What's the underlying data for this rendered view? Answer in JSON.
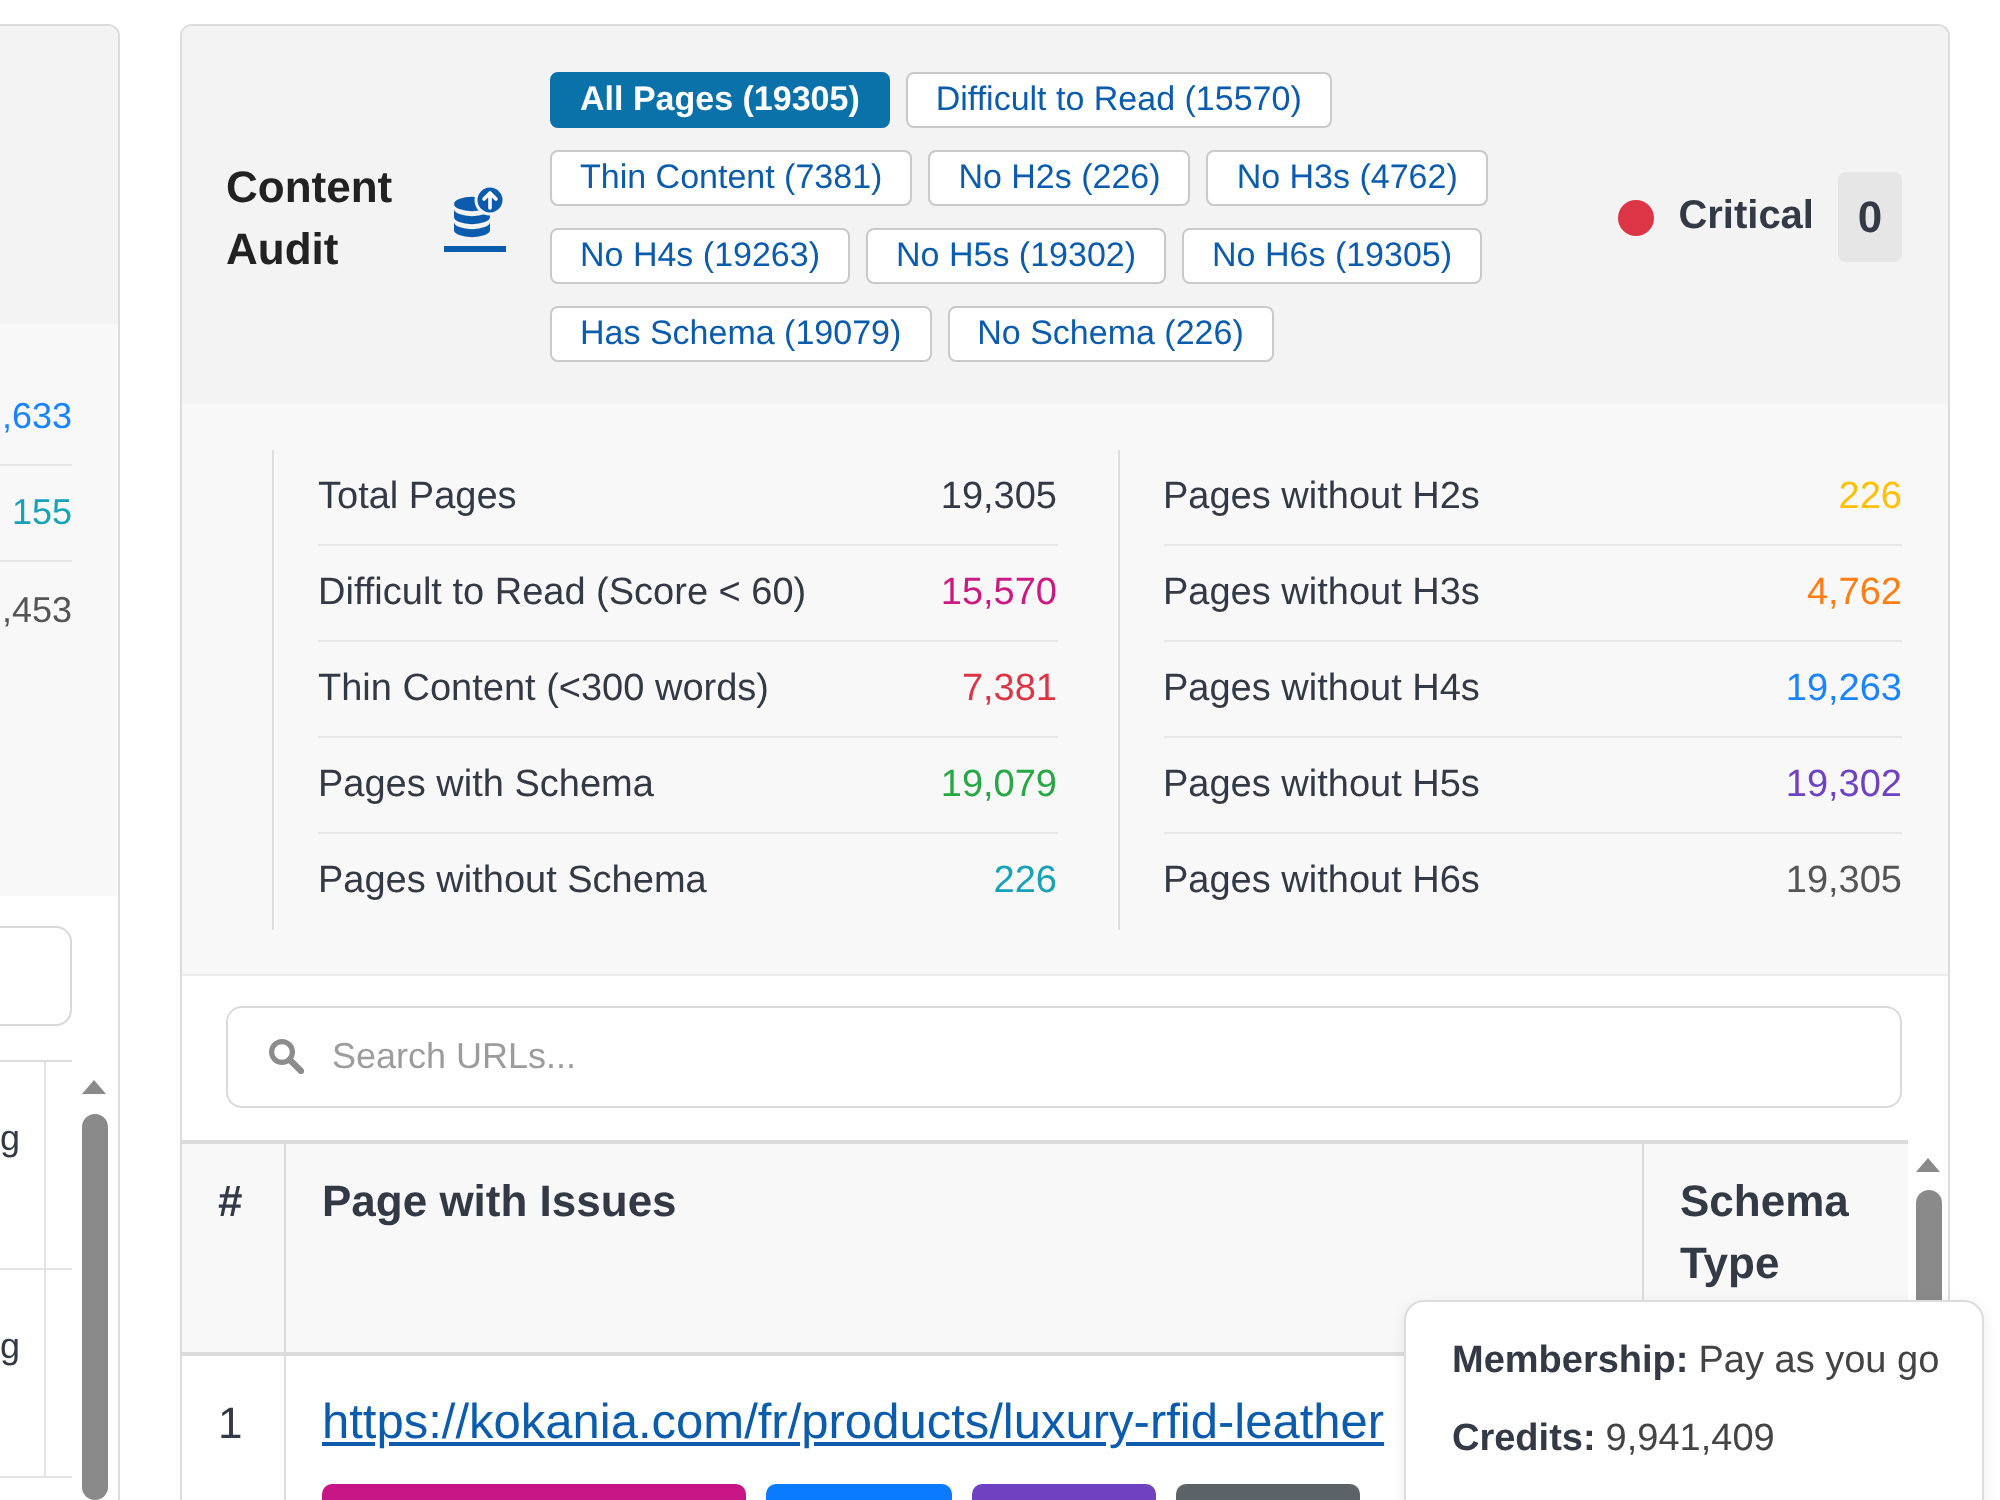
{
  "side_panel": {
    "stats": [
      {
        "value": ",633",
        "color": "#1a84ff"
      },
      {
        "value": "155",
        "color": "#17a2b8"
      },
      {
        "value": ",453",
        "color": "#555555"
      }
    ],
    "rows": [
      {
        "cell": "g"
      },
      {
        "cell": "g"
      }
    ]
  },
  "audit": {
    "title": "Content Audit",
    "filters": [
      {
        "label": "All Pages (19305)",
        "selected": true
      },
      {
        "label": "Difficult to Read (15570)",
        "selected": false
      },
      {
        "label": "Thin Content (7381)",
        "selected": false
      },
      {
        "label": "No H2s (226)",
        "selected": false
      },
      {
        "label": "No H3s (4762)",
        "selected": false
      },
      {
        "label": "No H4s (19263)",
        "selected": false
      },
      {
        "label": "No H5s (19302)",
        "selected": false
      },
      {
        "label": "No H6s (19305)",
        "selected": false
      },
      {
        "label": "Has Schema (19079)",
        "selected": false
      },
      {
        "label": "No Schema (226)",
        "selected": false
      }
    ],
    "severity": {
      "label": "Critical",
      "count": "0"
    }
  },
  "stat_columns": [
    {
      "items": [
        {
          "label": "Total Pages",
          "value": "19,305",
          "color": "#333a45"
        },
        {
          "label": "Difficult to Read (Score < 60)",
          "value": "15,570",
          "color": "#cc1a82"
        },
        {
          "label": "Thin Content (<300 words)",
          "value": "7,381",
          "color": "#dc3545"
        },
        {
          "label": "Pages with Schema",
          "value": "19,079",
          "color": "#28a745"
        },
        {
          "label": "Pages without Schema",
          "value": "226",
          "color": "#17a2b8"
        }
      ]
    },
    {
      "items": [
        {
          "label": "Pages without H2s",
          "value": "226",
          "color": "#ffc107"
        },
        {
          "label": "Pages without H3s",
          "value": "4,762",
          "color": "#fd7e14"
        },
        {
          "label": "Pages without H4s",
          "value": "19,263",
          "color": "#1a84ff"
        },
        {
          "label": "Pages without H5s",
          "value": "19,302",
          "color": "#6f42c1"
        },
        {
          "label": "Pages without H6s",
          "value": "19,305",
          "color": "#555555"
        }
      ]
    }
  ],
  "search": {
    "placeholder": "Search URLs..."
  },
  "table": {
    "columns": [
      "#",
      "Page with Issues",
      "Schema Type"
    ],
    "rows": [
      {
        "number": "1",
        "url": "https://kokania.com/fr/products/luxury-rfid-leather",
        "tags": [
          {
            "color": "#c71585"
          },
          {
            "color": "#0a7aff"
          },
          {
            "color": "#6f42c1"
          },
          {
            "color": "#5a6268"
          }
        ]
      }
    ]
  },
  "account_popup": {
    "lines": [
      {
        "label": "Membership:",
        "value": "Pay as you go"
      },
      {
        "label": "Credits:",
        "value": "9,941,409"
      }
    ]
  }
}
